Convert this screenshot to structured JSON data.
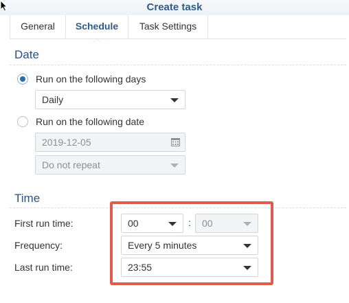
{
  "window": {
    "title": "Create task"
  },
  "tabs": [
    {
      "label": "General"
    },
    {
      "label": "Schedule"
    },
    {
      "label": "Task Settings"
    }
  ],
  "date_section": {
    "title": "Date",
    "option_days": {
      "label": "Run on the following days",
      "selected": true
    },
    "days_select": {
      "value": "Daily"
    },
    "option_date": {
      "label": "Run on the following date",
      "selected": false
    },
    "date_field": {
      "value": "2019-12-05",
      "icon": "calendar-icon"
    },
    "repeat_select": {
      "value": "Do not repeat"
    }
  },
  "time_section": {
    "title": "Time",
    "first_run": {
      "label": "First run time:",
      "hour": "00",
      "separator": ":",
      "minute": "00"
    },
    "frequency": {
      "label": "Frequency:",
      "value": "Every 5 minutes"
    },
    "last_run": {
      "label": "Last run time:",
      "value": "23:55"
    }
  },
  "colors": {
    "accent": "#2f5a8a",
    "highlight": "#e05a4e"
  }
}
